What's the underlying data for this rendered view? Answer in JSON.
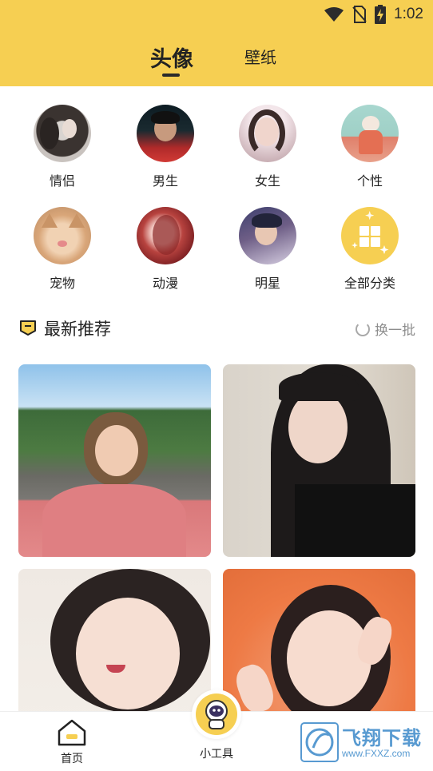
{
  "status_bar": {
    "time": "1:02"
  },
  "tabs": [
    {
      "label": "头像",
      "active": true
    },
    {
      "label": "壁纸",
      "active": false
    }
  ],
  "categories": [
    {
      "label": "情侣",
      "icon": "couple-avatar"
    },
    {
      "label": "男生",
      "icon": "boy-avatar"
    },
    {
      "label": "女生",
      "icon": "girl-avatar"
    },
    {
      "label": "个性",
      "icon": "personality-avatar"
    },
    {
      "label": "宠物",
      "icon": "pet-avatar"
    },
    {
      "label": "动漫",
      "icon": "anime-avatar"
    },
    {
      "label": "明星",
      "icon": "star-avatar"
    },
    {
      "label": "全部分类",
      "icon": "all-categories-icon"
    }
  ],
  "section": {
    "title": "最新推荐",
    "refresh_label": "换一批"
  },
  "bottom_nav": {
    "home_label": "首页",
    "tools_label": "小工具"
  },
  "watermark": {
    "title": "飞翔下载",
    "url": "www.FXXZ.com"
  },
  "colors": {
    "accent": "#f6cf52",
    "text": "#222222",
    "muted": "#8e8e8e",
    "watermark": "#3b89c9"
  }
}
